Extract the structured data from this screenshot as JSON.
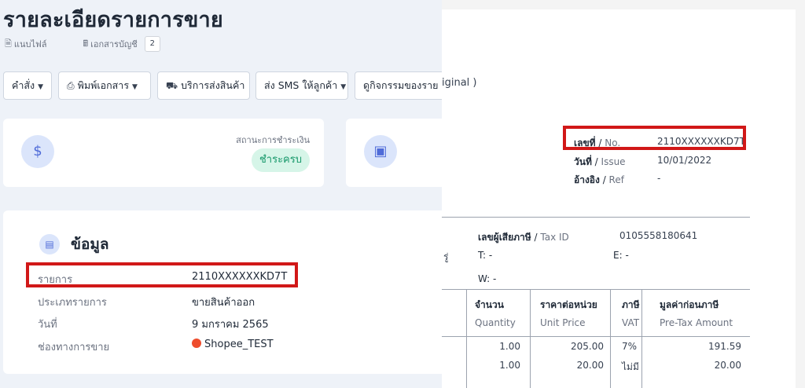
{
  "left_panel": {
    "title": "รายละเอียดรายการขาย",
    "sub_links": {
      "attach_label": "แนบไฟล์",
      "accounting_docs_label": "เอกสารบัญชี",
      "accounting_docs_count": "2"
    },
    "toolbar": {
      "command_label": "คำสั่ง",
      "print_docs_label": "พิมพ์เอกสาร",
      "shipping_label": "บริการส่งสินค้า",
      "sms_label": "ส่ง SMS ให้ลูกค้า",
      "activity_label": "ดูกิจกรรมของราย"
    },
    "payment_card": {
      "status_label": "สถานะการชำระเงิน",
      "status_value": "ชำระครบ"
    },
    "info_card": {
      "heading": "ข้อมูล",
      "rows": [
        {
          "key": "รายการ",
          "value": "2110XXXXXXKD7T"
        },
        {
          "key": "ประเภทรายการ",
          "value": "ขายสินค้าออก"
        },
        {
          "key": "วันที่",
          "value": "9 มกราคม 2565"
        },
        {
          "key": "ช่องทางการขาย",
          "value": "Shopee_TEST"
        }
      ]
    }
  },
  "document": {
    "header_fragment": "iginal )",
    "meta": [
      {
        "label_th": "เลขที่",
        "label_en": "No.",
        "value": "2110XXXXXXKD7T"
      },
      {
        "label_th": "วันที่",
        "label_en": "Issue",
        "value": "10/01/2022"
      },
      {
        "label_th": "อ้างอิง",
        "label_en": "Ref",
        "value": "-"
      }
    ],
    "tax_id": {
      "label_th": "เลขผู้เสียภาษี",
      "label_en": "Tax ID",
      "value": "0105558180641"
    },
    "t_line": "T: -",
    "e_line": "E: -",
    "w_line": "W: -",
    "left_fragment": "รู่",
    "columns": [
      {
        "th": "จำนวน",
        "en": "Quantity"
      },
      {
        "th": "ราคาต่อหน่วย",
        "en": "Unit Price"
      },
      {
        "th": "ภาษี",
        "en": "VAT"
      },
      {
        "th": "มูลค่าก่อนภาษี",
        "en": "Pre-Tax Amount"
      }
    ],
    "rows": [
      {
        "quantity": "1.00",
        "unit_price": "205.00",
        "vat": "7%",
        "pre_tax": "191.59"
      },
      {
        "quantity": "1.00",
        "unit_price": "20.00",
        "vat": "ไม่มี",
        "pre_tax": "20.00"
      }
    ]
  },
  "colors": {
    "highlight_border": "#d11818",
    "paid_badge_bg": "#d6f5e8",
    "paid_badge_text": "#16986a",
    "icon_circle_bg": "#dbe5fb",
    "icon_circle_fg": "#4f6bd8",
    "shopee_orange": "#ee4d2d"
  }
}
